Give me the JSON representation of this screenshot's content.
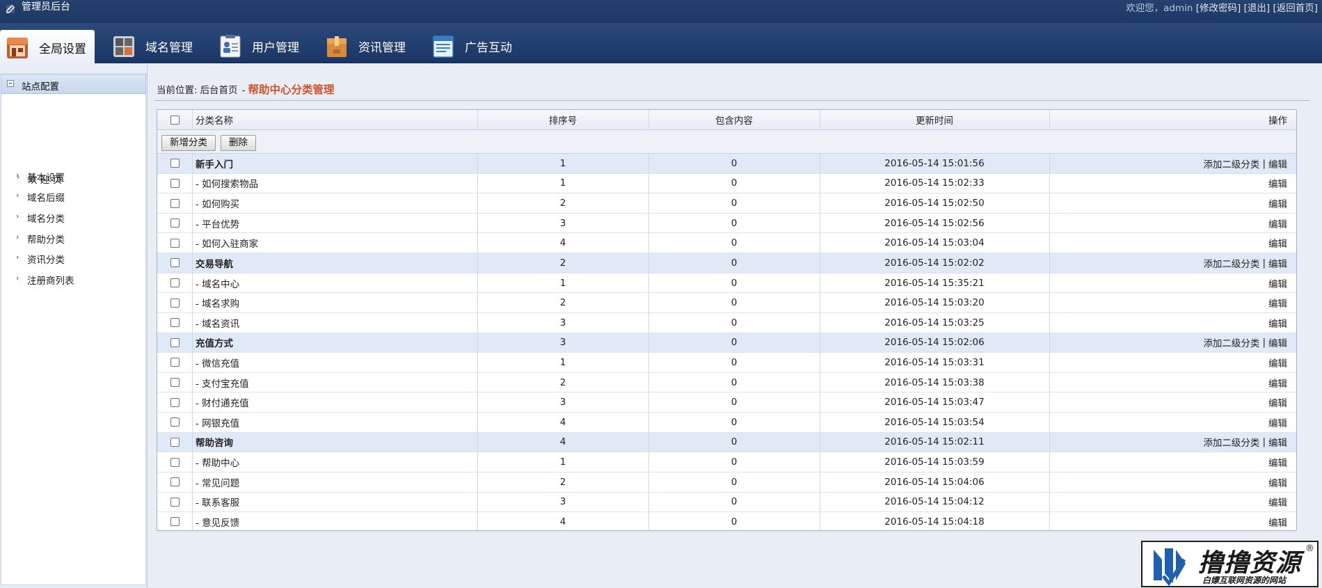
{
  "topbar": {
    "title": "管理员后台",
    "welcome": "欢迎您，",
    "username": "admin",
    "links": [
      "修改密码",
      "退出",
      "返回首页"
    ]
  },
  "nav": {
    "tabs": [
      {
        "label": "全局设置",
        "icon": "house-icon",
        "active": true
      },
      {
        "label": "域名管理",
        "icon": "grid-icon",
        "active": false
      },
      {
        "label": "用户管理",
        "icon": "user-card-icon",
        "active": false
      },
      {
        "label": "资讯管理",
        "icon": "box-icon",
        "active": false
      },
      {
        "label": "广告互动",
        "icon": "document-icon",
        "active": false
      }
    ]
  },
  "sidebar": {
    "title": "站点配置",
    "items": [
      "欢 迎 页",
      "基本设置",
      "域名后缀",
      "域名分类",
      "帮助分类",
      "资讯分类",
      "注册商列表"
    ]
  },
  "breadcrumb": {
    "prefix": "当前位置:",
    "home": "后台首页",
    "separator": "-",
    "current": "帮助中心分类管理"
  },
  "table": {
    "columns": [
      "分类名称",
      "排序号",
      "包含内容",
      "更新时间",
      "操作"
    ],
    "buttons": {
      "add": "新增分类",
      "delete": "删除"
    },
    "op_add_sub": "添加二级分类",
    "op_sep": "|",
    "op_edit": "编辑",
    "rows": [
      {
        "name": "新手入门",
        "sort": "1",
        "count": "0",
        "time": "2016-05-14 15:01:56",
        "group": true
      },
      {
        "name": "- 如何搜索物品",
        "sort": "1",
        "count": "0",
        "time": "2016-05-14 15:02:33",
        "group": false
      },
      {
        "name": "- 如何购买",
        "sort": "2",
        "count": "0",
        "time": "2016-05-14 15:02:50",
        "group": false
      },
      {
        "name": "- 平台优势",
        "sort": "3",
        "count": "0",
        "time": "2016-05-14 15:02:56",
        "group": false
      },
      {
        "name": "- 如何入驻商家",
        "sort": "4",
        "count": "0",
        "time": "2016-05-14 15:03:04",
        "group": false
      },
      {
        "name": "交易导航",
        "sort": "2",
        "count": "0",
        "time": "2016-05-14 15:02:02",
        "group": true
      },
      {
        "name": "- 域名中心",
        "sort": "1",
        "count": "0",
        "time": "2016-05-14 15:35:21",
        "group": false
      },
      {
        "name": "- 域名求购",
        "sort": "2",
        "count": "0",
        "time": "2016-05-14 15:03:20",
        "group": false
      },
      {
        "name": "- 域名资讯",
        "sort": "3",
        "count": "0",
        "time": "2016-05-14 15:03:25",
        "group": false
      },
      {
        "name": "充值方式",
        "sort": "3",
        "count": "0",
        "time": "2016-05-14 15:02:06",
        "group": true
      },
      {
        "name": "- 微信充值",
        "sort": "1",
        "count": "0",
        "time": "2016-05-14 15:03:31",
        "group": false
      },
      {
        "name": "- 支付宝充值",
        "sort": "2",
        "count": "0",
        "time": "2016-05-14 15:03:38",
        "group": false
      },
      {
        "name": "- 财付通充值",
        "sort": "3",
        "count": "0",
        "time": "2016-05-14 15:03:47",
        "group": false
      },
      {
        "name": "- 网银充值",
        "sort": "4",
        "count": "0",
        "time": "2016-05-14 15:03:54",
        "group": false
      },
      {
        "name": "帮助咨询",
        "sort": "4",
        "count": "0",
        "time": "2016-05-14 15:02:11",
        "group": true
      },
      {
        "name": "- 帮助中心",
        "sort": "1",
        "count": "0",
        "time": "2016-05-14 15:03:59",
        "group": false
      },
      {
        "name": "- 常见问题",
        "sort": "2",
        "count": "0",
        "time": "2016-05-14 15:04:06",
        "group": false
      },
      {
        "name": "- 联系客服",
        "sort": "3",
        "count": "0",
        "time": "2016-05-14 15:04:12",
        "group": false
      },
      {
        "name": "- 意见反馈",
        "sort": "4",
        "count": "0",
        "time": "2016-05-14 15:04:18",
        "group": false
      }
    ]
  },
  "watermark": {
    "main": "撸撸资源",
    "reg": "®",
    "sub": "白嫖互联网资源的网站"
  },
  "colors": {
    "header_bg": "#1d3864",
    "breadcrumb_current": "#d2522a",
    "group_row_bg": "#e0e9f6"
  }
}
